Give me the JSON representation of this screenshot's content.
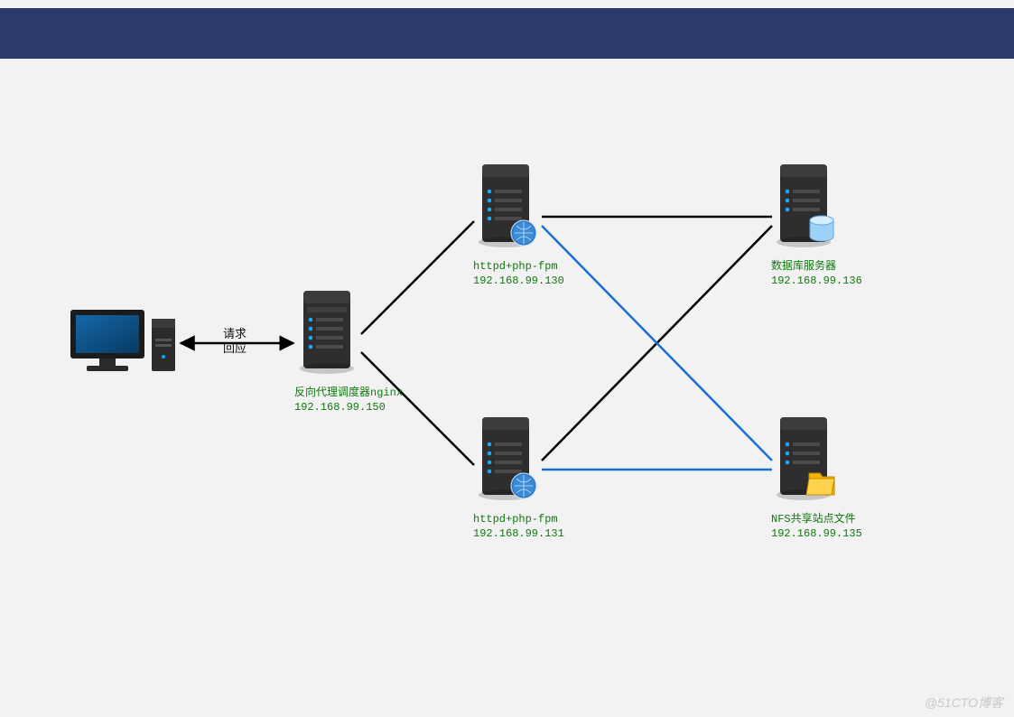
{
  "diagram": {
    "header_color": "#2b3a6b",
    "watermark": "@51CTO博客",
    "connection_label": {
      "line1": "请求",
      "line2": "回应"
    },
    "nodes": {
      "client": {
        "type": "workstation",
        "label": "",
        "ip": ""
      },
      "proxy": {
        "type": "server",
        "label": "反向代理调度器nginx",
        "ip": "192.168.99.150"
      },
      "web1": {
        "type": "webserver",
        "label": "httpd+php-fpm",
        "ip": "192.168.99.130"
      },
      "web2": {
        "type": "webserver",
        "label": "httpd+php-fpm",
        "ip": "192.168.99.131"
      },
      "db": {
        "type": "dbserver",
        "label": "数据库服务器",
        "ip": "192.168.99.136"
      },
      "nfs": {
        "type": "fileserver",
        "label": "NFS共享站点文件",
        "ip": "192.168.99.135"
      }
    },
    "links": [
      {
        "from": "client",
        "to": "proxy",
        "color": "black",
        "bidir": true
      },
      {
        "from": "proxy",
        "to": "web1",
        "color": "black"
      },
      {
        "from": "proxy",
        "to": "web2",
        "color": "black"
      },
      {
        "from": "web1",
        "to": "db",
        "color": "black"
      },
      {
        "from": "web2",
        "to": "db",
        "color": "black"
      },
      {
        "from": "web1",
        "to": "nfs",
        "color": "blue"
      },
      {
        "from": "web2",
        "to": "nfs",
        "color": "blue"
      }
    ]
  }
}
